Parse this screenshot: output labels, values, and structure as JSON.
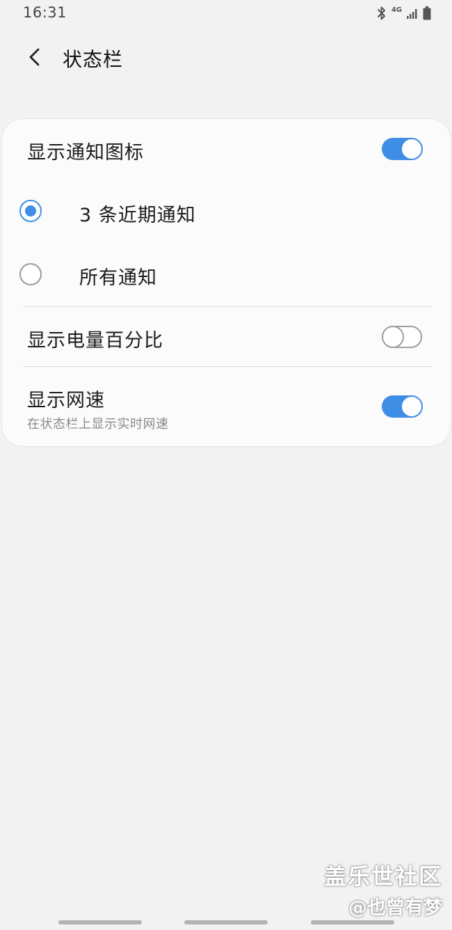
{
  "status_bar": {
    "time": "16:31",
    "network": "4G",
    "icons": [
      "bluetooth-icon",
      "signal-icon",
      "battery-icon"
    ]
  },
  "header": {
    "title": "状态栏",
    "back_icon": "chevron-left-icon"
  },
  "settings": {
    "show_notification_icons": {
      "label": "显示通知图标",
      "enabled": true
    },
    "notification_options": [
      {
        "label": "3 条近期通知",
        "selected": true
      },
      {
        "label": "所有通知",
        "selected": false
      }
    ],
    "show_battery_percent": {
      "label": "显示电量百分比",
      "enabled": false
    },
    "show_network_speed": {
      "label": "显示网速",
      "description": "在状态栏上显示实时网速",
      "enabled": true
    }
  },
  "colors": {
    "accent": "#3e8ee6",
    "background": "#f2f2f2",
    "card": "#fbfbfb"
  },
  "watermark": {
    "line1": "盖乐世社区",
    "line2": "@也曾有梦"
  }
}
